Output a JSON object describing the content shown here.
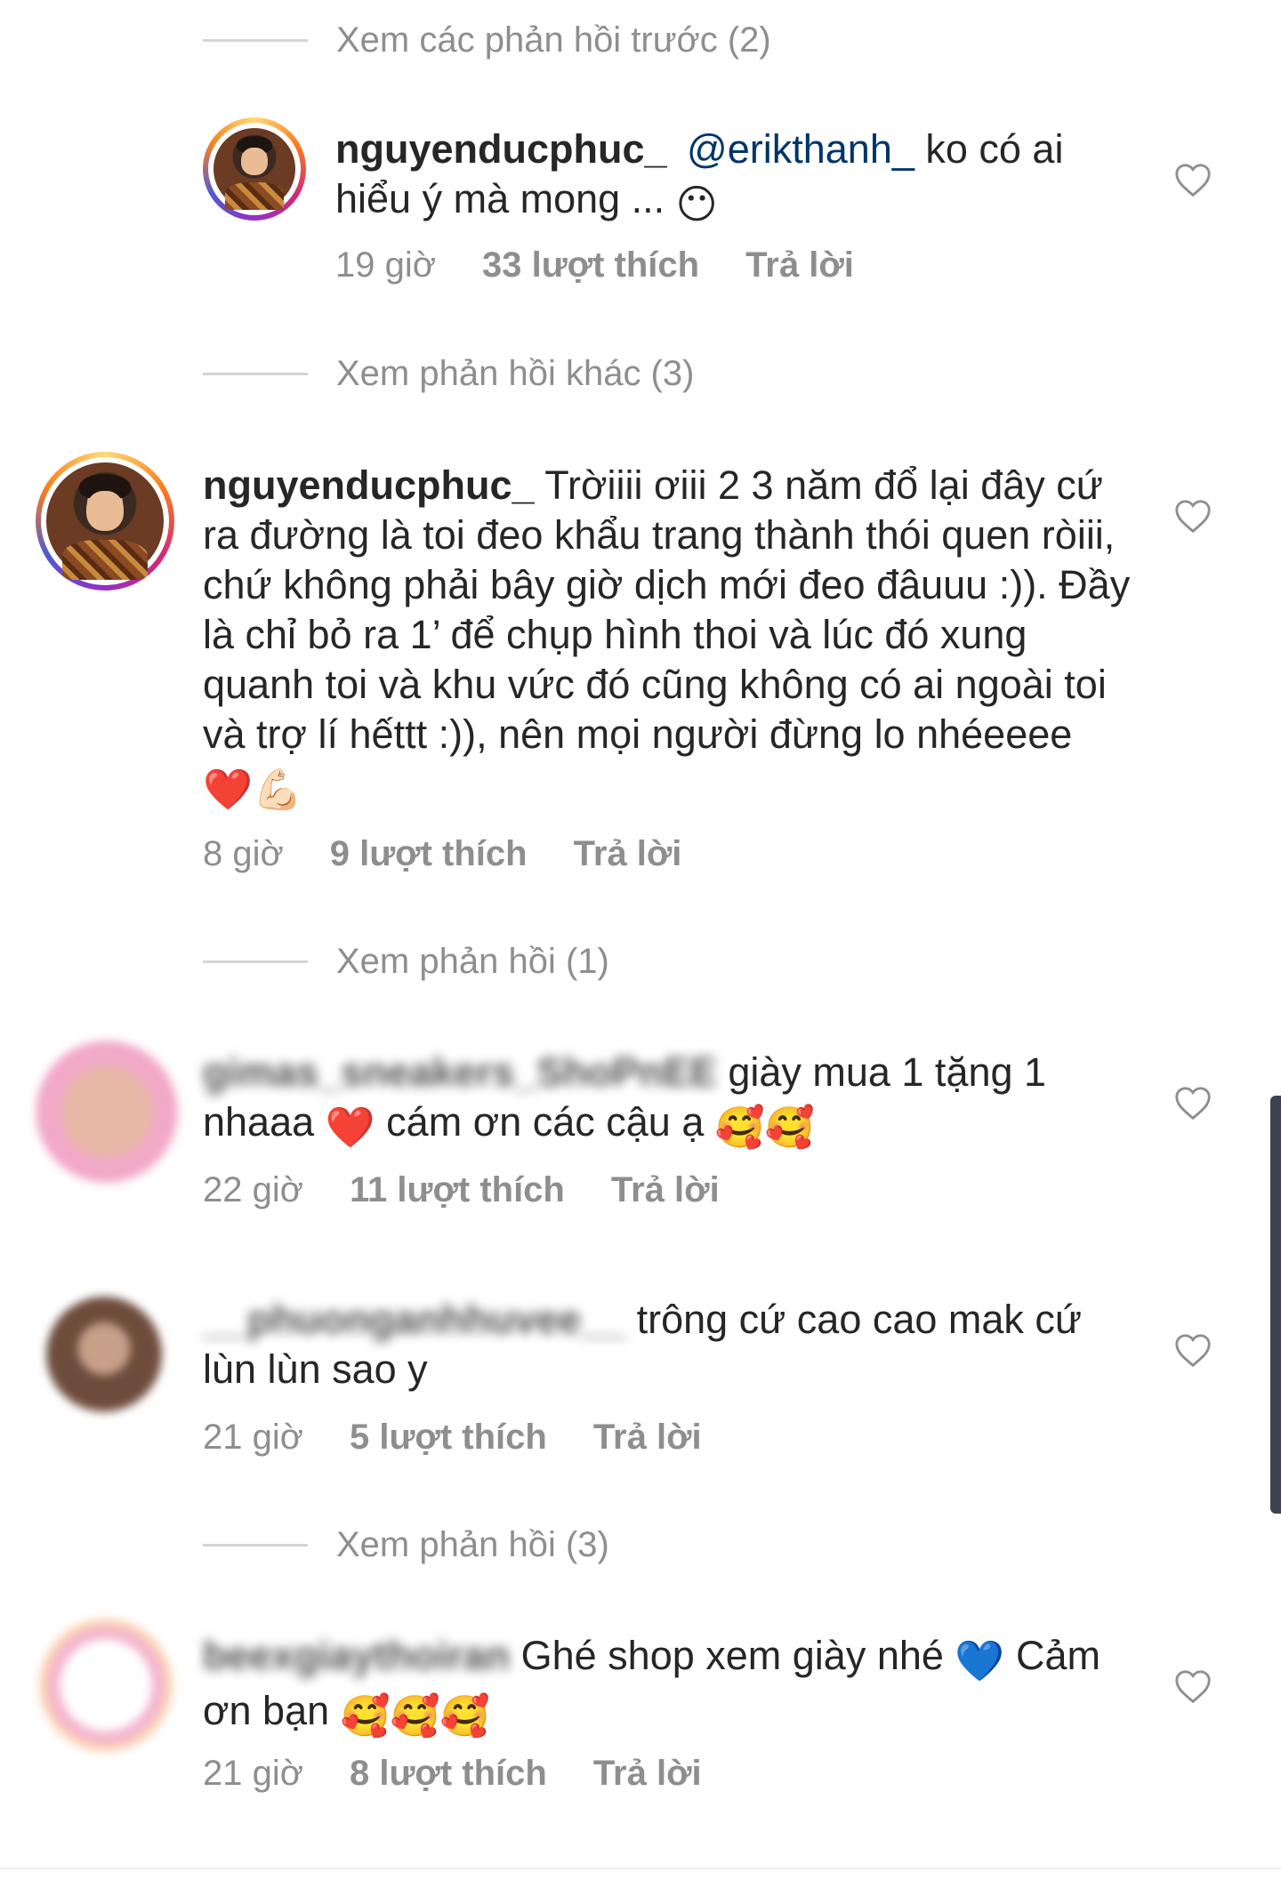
{
  "threads": {
    "prev_replies": "Xem các phản hồi trước (2)",
    "other_replies": "Xem phản hồi khác (3)",
    "replies_1": "Xem phản hồi (1)",
    "replies_3": "Xem phản hồi (3)"
  },
  "comments": [
    {
      "username": "nguyenducphuc_",
      "mention": "@erikthanh_",
      "text": " ko có ai hiểu ý mà mong ... ",
      "emoji": "😶",
      "time": "19 giờ",
      "likes": "33 lượt thích",
      "reply": "Trả lời"
    },
    {
      "username": "nguyenducphuc_",
      "text": " Trờiiii ơiii 2 3 năm đổ lại đây cứ ra đường là toi đeo khẩu trang thành thói quen ròiii, chứ không phải bây giờ dịch mới đeo đâuuu :)). Đầy là chỉ bỏ ra 1’ để chụp hình thoi và lúc đó xung quanh toi và khu vức đó cũng không có ai ngoài toi và trợ lí hếttt :)), nên mọi người đừng lo nhéeeee ",
      "emoji": "❤️💪🏻",
      "time": "8 giờ",
      "likes": "9 lượt thích",
      "reply": "Trả lời"
    },
    {
      "username": "gimas_sneakers_ShoPnEE",
      "text": "giày mua 1 tặng 1 nhaaa ",
      "emoji_a": "❤️",
      "text_b": " cám ơn các cậu ạ ",
      "emoji_b": "🥰🥰",
      "time": "22 giờ",
      "likes": "11 lượt thích",
      "reply": "Trả lời"
    },
    {
      "username": "__phuonganhhuvee__",
      "text": "trông cứ cao cao mak cứ lùn lùn sao y",
      "time": "21 giờ",
      "likes": "5 lượt thích",
      "reply": "Trả lời"
    },
    {
      "username": "beexgiaythoiran",
      "text": "Ghé shop xem giày nhé ",
      "emoji_a": "💙",
      "text_b": " Cảm ơn bạn ",
      "emoji_b": "🥰🥰🥰",
      "time": "21 giờ",
      "likes": "8 lượt thích",
      "reply": "Trả lời"
    }
  ],
  "icons": {
    "heart": "heart-outline-icon"
  },
  "colors": {
    "text": "#262626",
    "secondary": "#8e8e8e",
    "mention": "#003569",
    "line": "#d4d4d4"
  }
}
